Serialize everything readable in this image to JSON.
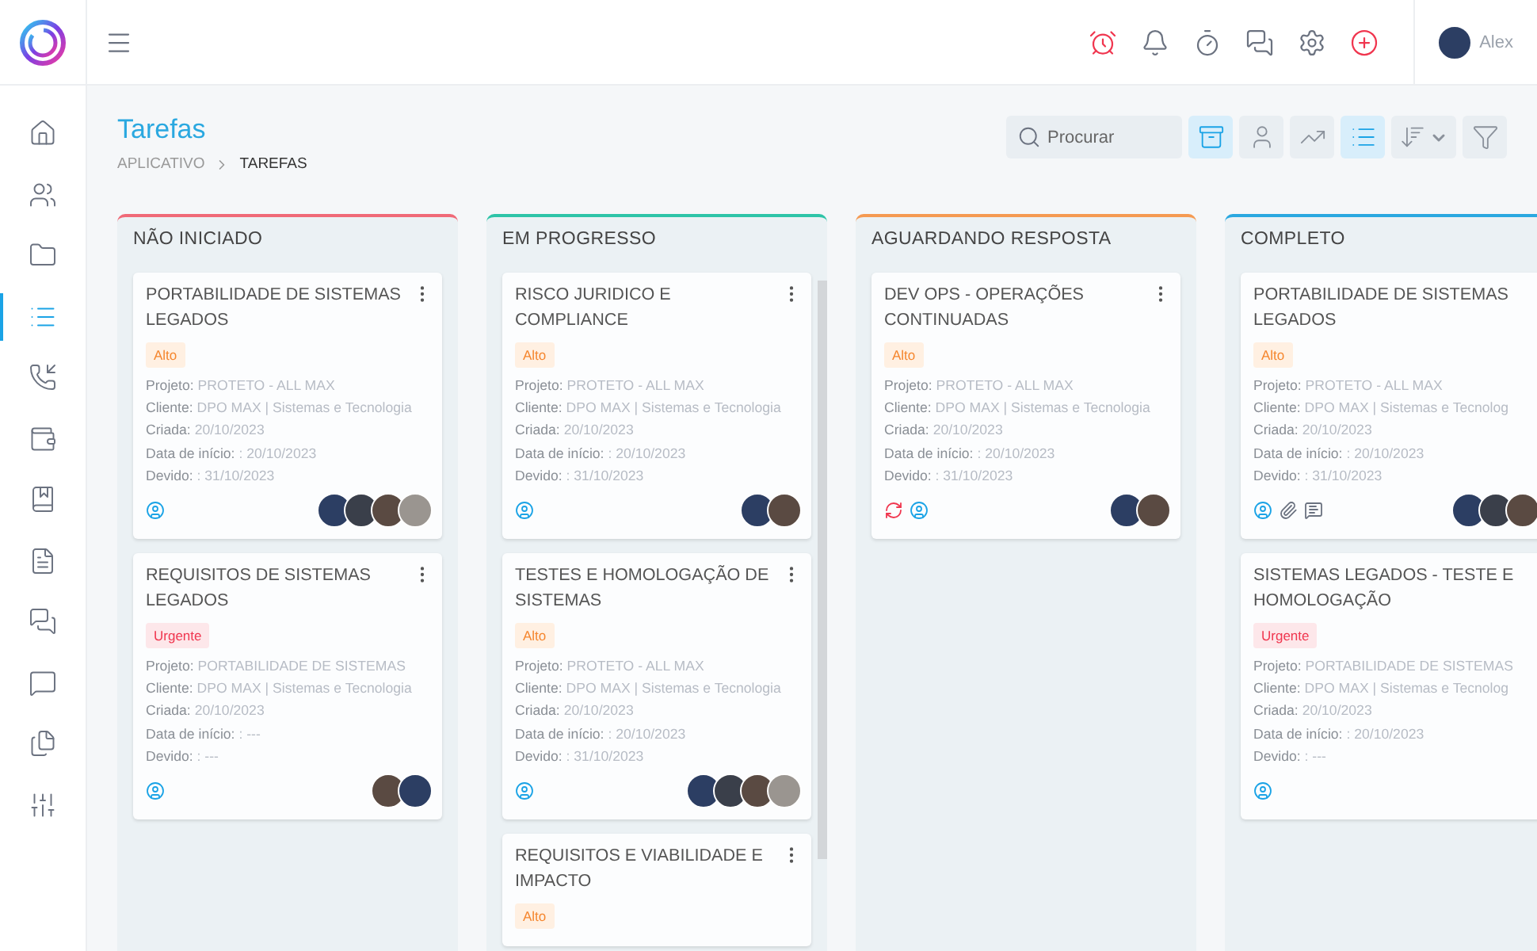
{
  "topbar": {
    "icons": [
      {
        "kind": "alarm",
        "alert": true
      },
      {
        "kind": "bell",
        "alert": false
      },
      {
        "kind": "timer",
        "alert": false
      },
      {
        "kind": "chat",
        "alert": false
      },
      {
        "kind": "settings",
        "alert": false
      },
      {
        "kind": "add",
        "alert": true
      }
    ],
    "user": {
      "name": "Alex"
    }
  },
  "sidebar": {
    "items": [
      {
        "kind": "home",
        "selected": false
      },
      {
        "kind": "users",
        "selected": false
      },
      {
        "kind": "folder",
        "selected": false
      },
      {
        "kind": "list",
        "selected": true
      },
      {
        "kind": "phone",
        "selected": false
      },
      {
        "kind": "wallet",
        "selected": false
      },
      {
        "kind": "book",
        "selected": false
      },
      {
        "kind": "file",
        "selected": false
      },
      {
        "kind": "chat",
        "selected": false
      },
      {
        "kind": "message",
        "selected": false
      },
      {
        "kind": "copy",
        "selected": false
      },
      {
        "kind": "sliders",
        "selected": false
      }
    ]
  },
  "page": {
    "title": "Tarefas",
    "breadcrumb": [
      {
        "label": "APLICATIVO",
        "current": false
      },
      {
        "label": "TAREFAS",
        "current": true
      }
    ]
  },
  "toolbar": {
    "search": {
      "placeholder": "Procurar"
    },
    "buttons": [
      {
        "kind": "archive",
        "selected": true
      },
      {
        "kind": "user",
        "selected": false
      },
      {
        "kind": "chart",
        "selected": false
      },
      {
        "kind": "list",
        "selected": true
      },
      {
        "kind": "sort",
        "selected": false
      },
      {
        "kind": "filter",
        "selected": false
      }
    ]
  },
  "columns": [
    {
      "title": "NÃO INICIADO",
      "color": "#f06a78",
      "cards": [
        {
          "title": "PORTABILIDADE DE SISTEMAS LEGADOS",
          "menu": true,
          "priority": {
            "label": "Alto",
            "kind": "high"
          },
          "fields": [
            {
              "label": "Projeto:",
              "value": "PROTETO - ALL MAX"
            },
            {
              "label": "Cliente:",
              "value": "DPO MAX | Sistemas e Tecnologia"
            },
            {
              "label": "Criada:",
              "value": "20/10/2023"
            },
            {
              "label": "Data de início:",
              "value": ": 20/10/2023"
            },
            {
              "label": "Devido:",
              "value": ": 31/10/2023"
            }
          ],
          "icons": [
            {
              "kind": "user"
            }
          ],
          "avatars": [
            {
              "color": "#2c3e63"
            },
            {
              "color": "#3a3f4a"
            },
            {
              "color": "#5a4a42"
            },
            {
              "color": "#9a9590"
            }
          ]
        },
        {
          "title": "REQUISITOS DE SISTEMAS LEGADOS",
          "menu": true,
          "priority": {
            "label": "Urgente",
            "kind": "urgent"
          },
          "fields": [
            {
              "label": "Projeto:",
              "value": "PORTABILIDADE DE SISTEMAS"
            },
            {
              "label": "Cliente:",
              "value": "DPO MAX | Sistemas e Tecnologia"
            },
            {
              "label": "Criada:",
              "value": "20/10/2023"
            },
            {
              "label": "Data de início:",
              "value": ": ---"
            },
            {
              "label": "Devido:",
              "value": ": ---"
            }
          ],
          "icons": [
            {
              "kind": "user"
            }
          ],
          "avatars": [
            {
              "color": "#5a4a42"
            },
            {
              "color": "#2c3e63"
            }
          ]
        }
      ]
    },
    {
      "title": "EM PROGRESSO",
      "color": "#2ec4a8",
      "cards": [
        {
          "title": "RISCO JURIDICO E COMPLIANCE",
          "menu": true,
          "priority": {
            "label": "Alto",
            "kind": "high"
          },
          "fields": [
            {
              "label": "Projeto:",
              "value": "PROTETO - ALL MAX"
            },
            {
              "label": "Cliente:",
              "value": "DPO MAX | Sistemas e Tecnologia"
            },
            {
              "label": "Criada:",
              "value": "20/10/2023"
            },
            {
              "label": "Data de início:",
              "value": ": 20/10/2023"
            },
            {
              "label": "Devido:",
              "value": ": 31/10/2023"
            }
          ],
          "icons": [
            {
              "kind": "user"
            }
          ],
          "avatars": [
            {
              "color": "#2c3e63"
            },
            {
              "color": "#5a4a42"
            }
          ]
        },
        {
          "title": "TESTES E HOMOLOGAÇÃO DE SISTEMAS",
          "menu": true,
          "priority": {
            "label": "Alto",
            "kind": "high"
          },
          "fields": [
            {
              "label": "Projeto:",
              "value": "PROTETO - ALL MAX"
            },
            {
              "label": "Cliente:",
              "value": "DPO MAX | Sistemas e Tecnologia"
            },
            {
              "label": "Criada:",
              "value": "20/10/2023"
            },
            {
              "label": "Data de início:",
              "value": ": 20/10/2023"
            },
            {
              "label": "Devido:",
              "value": ": 31/10/2023"
            }
          ],
          "icons": [
            {
              "kind": "user"
            }
          ],
          "avatars": [
            {
              "color": "#2c3e63"
            },
            {
              "color": "#3a3f4a"
            },
            {
              "color": "#5a4a42"
            },
            {
              "color": "#9a9590"
            }
          ]
        },
        {
          "title": "REQUISITOS E VIABILIDADE E IMPACTO",
          "menu": true,
          "priority": {
            "label": "Alto",
            "kind": "high"
          }
        }
      ]
    },
    {
      "title": "AGUARDANDO RESPOSTA",
      "color": "#f59a52",
      "cards": [
        {
          "title": "DEV OPS - OPERAÇÕES CONTINUADAS",
          "menu": true,
          "priority": {
            "label": "Alto",
            "kind": "high"
          },
          "fields": [
            {
              "label": "Projeto:",
              "value": "PROTETO - ALL MAX"
            },
            {
              "label": "Cliente:",
              "value": "DPO MAX | Sistemas e Tecnologia"
            },
            {
              "label": "Criada:",
              "value": "20/10/2023"
            },
            {
              "label": "Data de início:",
              "value": ": 20/10/2023"
            },
            {
              "label": "Devido:",
              "value": ": 31/10/2023"
            }
          ],
          "icons": [
            {
              "kind": "sync"
            },
            {
              "kind": "user"
            }
          ],
          "avatars": [
            {
              "color": "#2c3e63"
            },
            {
              "color": "#5a4a42"
            }
          ]
        }
      ]
    },
    {
      "title": "COMPLETO",
      "color": "#2aa8e0",
      "cards": [
        {
          "title": "PORTABILIDADE DE SISTEMAS LEGADOS",
          "menu": false,
          "priority": {
            "label": "Alto",
            "kind": "high"
          },
          "fields": [
            {
              "label": "Projeto:",
              "value": "PROTETO - ALL MAX"
            },
            {
              "label": "Cliente:",
              "value": "DPO MAX | Sistemas e Tecnolog"
            },
            {
              "label": "Criada:",
              "value": "20/10/2023"
            },
            {
              "label": "Data de início:",
              "value": ": 20/10/2023"
            },
            {
              "label": "Devido:",
              "value": ": 31/10/2023"
            }
          ],
          "icons": [
            {
              "kind": "user"
            },
            {
              "kind": "attachment"
            },
            {
              "kind": "comment"
            }
          ],
          "avatars": [
            {
              "color": "#2c3e63"
            },
            {
              "color": "#3a3f4a"
            },
            {
              "color": "#5a4a42"
            }
          ]
        },
        {
          "title": "SISTEMAS LEGADOS - TESTE E HOMOLOGAÇÃO",
          "menu": false,
          "priority": {
            "label": "Urgente",
            "kind": "urgent"
          },
          "fields": [
            {
              "label": "Projeto:",
              "value": "PORTABILIDADE DE SISTEMAS"
            },
            {
              "label": "Cliente:",
              "value": "DPO MAX | Sistemas e Tecnolog"
            },
            {
              "label": "Criada:",
              "value": "20/10/2023"
            },
            {
              "label": "Data de início:",
              "value": ": 20/10/2023"
            },
            {
              "label": "Devido:",
              "value": ": ---"
            }
          ],
          "icons": [
            {
              "kind": "user"
            }
          ]
        }
      ]
    }
  ]
}
